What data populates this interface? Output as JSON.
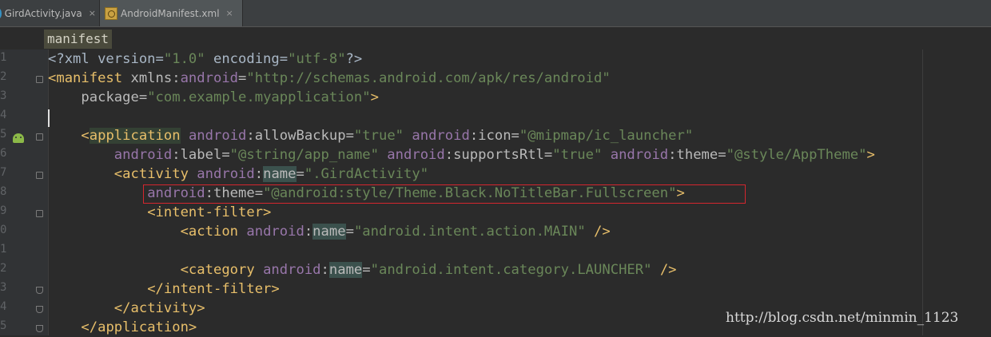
{
  "tabs": [
    {
      "label": "GirdActivity.java",
      "close": "×"
    },
    {
      "label": "AndroidManifest.xml",
      "close": "×"
    }
  ],
  "breadcrumb": "manifest",
  "line_numbers": [
    "1",
    "2",
    "3",
    "4",
    "5",
    "6",
    "7",
    "8",
    "9",
    "0",
    "1",
    "2",
    "3",
    "4",
    "5"
  ],
  "code": {
    "l1": {
      "pre": "<?xml version=",
      "v1": "\"1.0\"",
      "mid": " encoding=",
      "v2": "\"utf-8\"",
      "end": "?>"
    },
    "l2": {
      "tag": "<manifest",
      "attr": " xmlns:",
      "ns": "android",
      "eq": "=",
      "val": "\"http://schemas.android.com/apk/res/android\""
    },
    "l3": {
      "indent": "    ",
      "attr": "package=",
      "val": "\"com.example.myapplication\"",
      "end": ">"
    },
    "l5": {
      "indent": "    ",
      "open": "<",
      "tag": "application",
      "ns1": "android",
      "attr1": ":allowBackup=",
      "val1": "\"true\"",
      "ns2": "android",
      "attr2": ":icon=",
      "val2": "\"@mipmap/ic_launcher\""
    },
    "l6": {
      "indent": "        ",
      "ns1": "android",
      "attr1": ":label=",
      "val1": "\"@string/app_name\"",
      "ns2": "android",
      "attr2": ":supportsRtl=",
      "val2": "\"true\"",
      "ns3": "android",
      "attr3": ":theme=",
      "val3": "\"@style/AppTheme\"",
      "end": ">"
    },
    "l7": {
      "indent": "        ",
      "tag": "<activity",
      "ns": "android",
      "colon": ":",
      "name": "name",
      "eq": "=",
      "val": "\".GirdActivity\""
    },
    "l8": {
      "indent": "            ",
      "ns": "android",
      "attr": ":theme=",
      "val": "\"@android:style/Theme.Black.NoTitleBar.Fullscreen\"",
      "end": ">"
    },
    "l9": {
      "indent": "            ",
      "tag": "<intent-filter>"
    },
    "l10": {
      "indent": "                ",
      "tag": "<action",
      "ns": "android",
      "colon": ":",
      "name": "name",
      "eq": "=",
      "val": "\"android.intent.action.MAIN\"",
      "end": " />"
    },
    "l12": {
      "indent": "                ",
      "tag": "<category",
      "ns": "android",
      "colon": ":",
      "name": "name",
      "eq": "=",
      "val": "\"android.intent.category.LAUNCHER\"",
      "end": " />"
    },
    "l13": {
      "indent": "            ",
      "tag": "</intent-filter>"
    },
    "l14": {
      "indent": "        ",
      "tag": "</activity>"
    },
    "l15": {
      "indent": "    ",
      "tag": "</application>"
    }
  },
  "watermark": "http://blog.csdn.net/minmin_1123",
  "colors": {
    "background": "#2b2b2b",
    "tag": "#e8bf6a",
    "namespace": "#9876aa",
    "value": "#6a8759",
    "highlight_box": "#d4262e"
  }
}
